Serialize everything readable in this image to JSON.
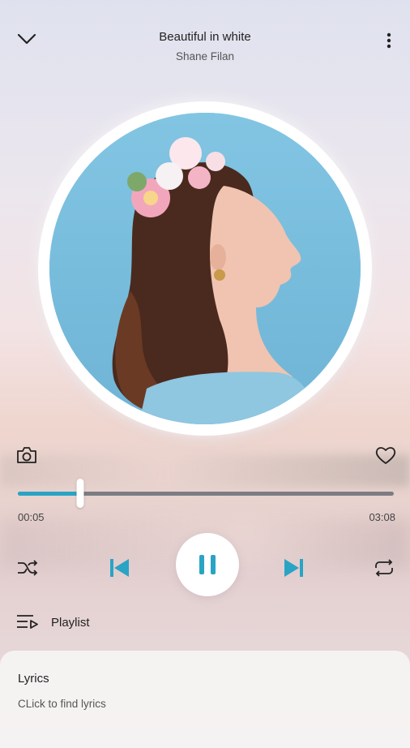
{
  "header": {
    "title": "Beautiful in white",
    "artist": "Shane Filan",
    "collapse_icon": "chevron-down-icon",
    "more_icon": "more-vertical-icon"
  },
  "artwork": {
    "description_icon": "album-art"
  },
  "actions": {
    "camera_icon": "camera-icon",
    "favorite_icon": "heart-icon"
  },
  "progress": {
    "elapsed": "00:05",
    "duration": "03:08",
    "fraction": 0.165
  },
  "controls": {
    "shuffle_icon": "shuffle-icon",
    "previous_icon": "skip-previous-icon",
    "play_pause_icon": "pause-icon",
    "next_icon": "skip-next-icon",
    "repeat_icon": "repeat-icon"
  },
  "playlist": {
    "label": "Playlist",
    "icon": "playlist-icon"
  },
  "lyrics": {
    "title": "Lyrics",
    "hint": "CLick to find lyrics"
  },
  "colors": {
    "accent": "#2aa4c4",
    "track": "#7d7c83",
    "artwork_bg": "#7ec0de"
  }
}
